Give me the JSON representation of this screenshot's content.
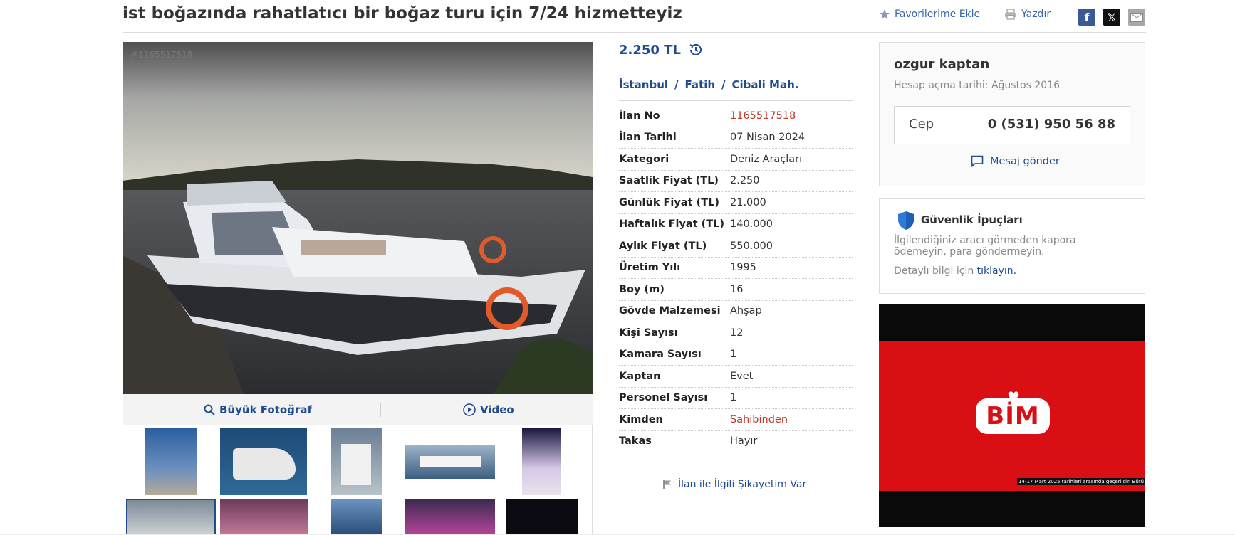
{
  "header": {
    "title": "ist boğazında rahatlatıcı bir boğaz turu için 7/24 hizmetteyiz",
    "favorite_label": "Favorilerime Ekle",
    "print_label": "Yazdır"
  },
  "photo": {
    "watermark_id": "#1165517518",
    "big_photo_label": "Büyük Fotoğraf",
    "video_label": "Video"
  },
  "listing": {
    "price": "2.250 TL",
    "breadcrumbs": [
      "İstanbul",
      "Fatih",
      "Cibali Mah."
    ],
    "breadcrumb_sep": "/",
    "details": [
      {
        "key": "İlan No",
        "value": "1165517518"
      },
      {
        "key": "İlan Tarihi",
        "value": "07 Nisan 2024"
      },
      {
        "key": "Kategori",
        "value": "Deniz Araçları"
      },
      {
        "key": "Saatlik Fiyat (TL)",
        "value": "2.250"
      },
      {
        "key": "Günlük Fiyat (TL)",
        "value": "21.000"
      },
      {
        "key": "Haftalık Fiyat (TL)",
        "value": "140.000"
      },
      {
        "key": "Aylık Fiyat (TL)",
        "value": "550.000"
      },
      {
        "key": "Üretim Yılı",
        "value": "1995"
      },
      {
        "key": "Boy (m)",
        "value": "16"
      },
      {
        "key": "Gövde Malzemesi",
        "value": "Ahşap"
      },
      {
        "key": "Kişi Sayısı",
        "value": "12"
      },
      {
        "key": "Kamara Sayısı",
        "value": "1"
      },
      {
        "key": "Kaptan",
        "value": "Evet"
      },
      {
        "key": "Personel Sayısı",
        "value": "1"
      },
      {
        "key": "Kimden",
        "value": "Sahibinden"
      },
      {
        "key": "Takas",
        "value": "Hayır"
      }
    ],
    "complaint_label": "İlan ile İlgili Şikayetim Var"
  },
  "seller": {
    "name": "ozgur kaptan",
    "since": "Hesap açma tarihi: Ağustos 2016",
    "phone_label": "Cep",
    "phone": "0 (531) 950 56 88",
    "message_label": "Mesaj gönder"
  },
  "safety": {
    "title": "Güvenlik İpuçları",
    "text": "İlgilendiğiniz aracı görmeden kapora ödemeyin, para göndermeyin.",
    "more_prefix": "Detaylı bilgi için",
    "more_link": "tıklayın."
  },
  "ad": {
    "brand": "BİM",
    "fineprint": "14-17 Mart 2025 tarihleri arasında geçerlidir. Bütü"
  },
  "colors": {
    "link_blue": "#1f4b8f",
    "accent_red": "#c0392b",
    "ad_red": "#d90f14"
  }
}
